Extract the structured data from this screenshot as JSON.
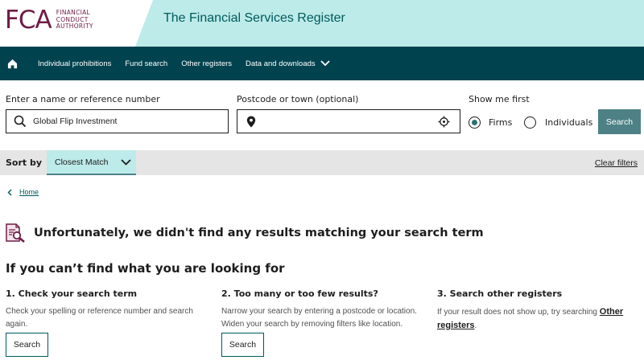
{
  "header": {
    "logo_mark": "FCA",
    "logo_lines": [
      "FINANCIAL",
      "CONDUCT",
      "AUTHORITY"
    ],
    "site_title": "The Financial Services Register"
  },
  "nav": {
    "items": [
      {
        "label": "Individual prohibitions"
      },
      {
        "label": "Fund search"
      },
      {
        "label": "Other registers"
      },
      {
        "label": "Data and downloads"
      }
    ]
  },
  "search": {
    "name_label": "Enter a name or reference number",
    "name_value": "Global Flip Investment",
    "postcode_label": "Postcode or town (optional)",
    "postcode_value": "",
    "show_label": "Show me first",
    "options": [
      {
        "label": "Firms",
        "selected": true
      },
      {
        "label": "Individuals",
        "selected": false
      }
    ],
    "button": "Search"
  },
  "sort": {
    "label": "Sort by",
    "value": "Closest Match",
    "clear": "Clear filters"
  },
  "breadcrumb": {
    "home": "Home"
  },
  "results": {
    "no_results": "Unfortunately, we didn't find any results matching your search term",
    "help_title": "If you can’t find what you are looking for",
    "columns": [
      {
        "title": "1. Check your search term",
        "text": "Check your spelling or reference number and search again.",
        "button": "Search"
      },
      {
        "title": "2. Too many or too few results?",
        "text": "Narrow your search by entering a postcode or location. Widen your search by removing filters like location.",
        "button": "Search"
      },
      {
        "title": "3. Search other registers",
        "text_before": "If your result does not show up, try searching ",
        "link": "Other registers",
        "text_after": "."
      }
    ]
  },
  "colors": {
    "brand": "#701b45",
    "nav_bg": "#00434f",
    "accent_teal": "#bdebe9",
    "button": "#4d8186"
  }
}
